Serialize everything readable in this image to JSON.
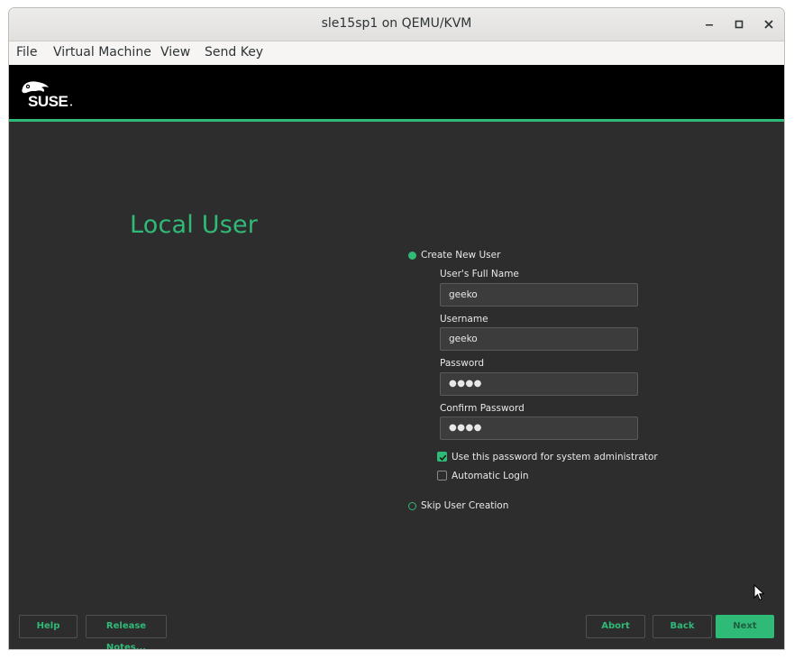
{
  "window": {
    "title": "sle15sp1 on QEMU/KVM",
    "controls": {
      "minimize": "‒",
      "maximize": "◻",
      "close": "✕"
    }
  },
  "menubar": {
    "items": [
      "File",
      "Virtual Machine",
      "View",
      "Send Key"
    ]
  },
  "installer": {
    "logo_text": "SUSE",
    "accent_color": "#30ba78",
    "page_title": "Local User",
    "create_new_user": {
      "label": "Create New User",
      "selected": true
    },
    "fields": {
      "full_name": {
        "label": "User's Full Name",
        "value": "geeko"
      },
      "username": {
        "label": "Username",
        "value": "geeko"
      },
      "password": {
        "label": "Password",
        "value": "●●●●"
      },
      "confirm_password": {
        "label": "Confirm Password",
        "value": "●●●●"
      }
    },
    "use_password_for_admin": {
      "label": "Use this password for system administrator",
      "checked": true
    },
    "automatic_login": {
      "label": "Automatic Login",
      "checked": false
    },
    "skip_user_creation": {
      "label": "Skip User Creation",
      "selected": false
    },
    "buttons": {
      "help": "Help",
      "release_notes": "Release Notes...",
      "abort": "Abort",
      "back": "Back",
      "next": "Next"
    }
  }
}
